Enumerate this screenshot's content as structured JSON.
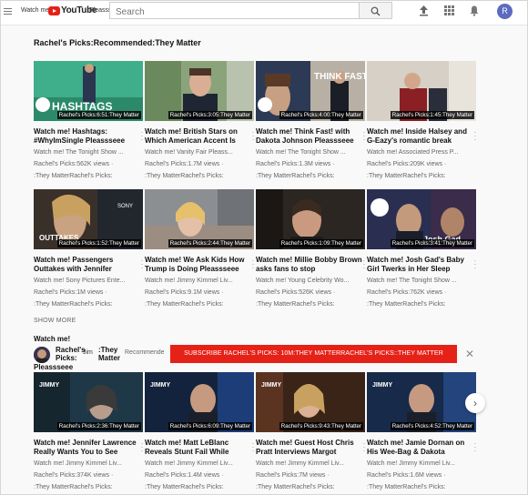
{
  "header": {
    "logo_prefix": "Watch me!",
    "logo_word": "YouTube",
    "logo_suffix": "Pleassseee",
    "search_placeholder": "Search",
    "avatar_letter": "R"
  },
  "section1": {
    "title": "Rachel's Picks:Recommended:They Matter",
    "videos": [
      {
        "badge": "Rachel's Picks:6:51:They Matter",
        "title": "Watch me! Hashtags: #WhyImSingle Pleassseee",
        "channel": "Watch me! The Tonight Show ...",
        "views": "Rachel's Picks:562K views ·",
        "age": ":They MatterRachel's Picks:",
        "overlay": "HASHTAGS"
      },
      {
        "badge": "Rachel's Picks:3:05:They Matter",
        "title": "Watch me! British Stars on Which American Accent Is",
        "channel": "Watch me! Vanity Fair Pleass...",
        "views": "Rachel's Picks:1.7M views ·",
        "age": ":They MatterRachel's Picks:",
        "overlay": ""
      },
      {
        "badge": "Rachel's Picks:4:00:They Matter",
        "title": "Watch me! Think Fast! with Dakota Johnson Pleassseee",
        "channel": "Watch me! The Tonight Show ...",
        "views": "Rachel's Picks:1.3M views ·",
        "age": ":They MatterRachel's Picks:",
        "overlay": "THINK FAST!"
      },
      {
        "badge": "Rachel's Picks:1:45:They Matter",
        "title": "Watch me! Inside Halsey and G-Eazy's romantic break",
        "channel": "Watch me! Associated Press P...",
        "views": "Rachel's Picks:209K views ·",
        "age": ":They MatterRachel's Picks:",
        "overlay": ""
      }
    ]
  },
  "section2": {
    "videos": [
      {
        "badge": "Rachel's Picks:1:52:They Matter",
        "title": "Watch me! Passengers Outtakes with Jennifer",
        "channel": "Watch me! Sony Pictures Ente...",
        "views": "Rachel's Picks:1M views ·",
        "age": ":They MatterRachel's Picks:",
        "overlay": "OUTTAKES"
      },
      {
        "badge": "Rachel's Picks:2:44:They Matter",
        "title": "Watch me! We Ask Kids How Trump is Doing Pleassseee",
        "channel": "Watch me! Jimmy Kimmel Liv...",
        "views": "Rachel's Picks:9.1M views ·",
        "age": ":They MatterRachel's Picks:",
        "overlay": ""
      },
      {
        "badge": "Rachel's Picks:1:09:They Matter",
        "title": "Watch me! Millie Bobby Brown asks fans to stop",
        "channel": "Watch me! Young Celebrity Wo...",
        "views": "Rachel's Picks:526K views ·",
        "age": ":They MatterRachel's Picks:",
        "overlay": ""
      },
      {
        "badge": "Rachel's Picks:3:41:They Matter",
        "title": "Watch me! Josh Gad's Baby Girl Twerks in Her Sleep",
        "channel": "Watch me! The Tonight Show ...",
        "views": "Rachel's Picks:762K views ·",
        "age": ":They MatterRachel's Picks:",
        "overlay": "Josh Gad"
      }
    ]
  },
  "show_more": "SHOW MORE",
  "shelf": {
    "watch": "Watch me!",
    "channel_line1": "Rachel's",
    "channel_line2": "Picks:",
    "channel_mid": "Jim",
    "channel_suffix1": ":They",
    "channel_suffix2": "Matter",
    "channel_line3": "Pleassseee",
    "recommended": "Recommende",
    "subscribe": "SUBSCRIBE RACHEL'S PICKS:  10M:THEY MATTERRACHEL'S PICKS::THEY MATTER",
    "videos": [
      {
        "badge": "Rachel's Picks:2:36:They Matter",
        "title": "Watch me! Jennifer Lawrence Really Wants You to See",
        "channel": "Watch me! Jimmy Kimmel Liv...",
        "views": "Rachel's Picks:374K views ·",
        "age": ":They MatterRachel's Picks:",
        "overlay": "JIMMY"
      },
      {
        "badge": "Rachel's Picks:6:09:They Matter",
        "title": "Watch me! Matt LeBlanc Reveals Stunt Fail While",
        "channel": "Watch me! Jimmy Kimmel Liv...",
        "views": "Rachel's Picks:1.4M views ·",
        "age": ":They MatterRachel's Picks:",
        "overlay": "JIMMY"
      },
      {
        "badge": "Rachel's Picks:9:43:They Matter",
        "title": "Watch me! Guest Host Chris Pratt Interviews Margot",
        "channel": "Watch me! Jimmy Kimmel Liv...",
        "views": "Rachel's Picks:7M views ·",
        "age": ":They MatterRachel's Picks:",
        "overlay": "JIMMY"
      },
      {
        "badge": "Rachel's Picks:4:52:They Matter",
        "title": "Watch me! Jamie Dornan on His Wee-Bag & Dakota",
        "channel": "Watch me! Jimmy Kimmel Liv...",
        "views": "Rachel's Picks:1.6M views ·",
        "age": ":They MatterRachel's Picks:",
        "overlay": "JIMMY"
      }
    ]
  },
  "colors": {
    "brand": "#e62117",
    "avatar": "#5c6bc0"
  },
  "icons": [
    "menu-icon",
    "search-icon",
    "upload-icon",
    "apps-icon",
    "bell-icon",
    "close-icon",
    "chevron-right-icon"
  ]
}
